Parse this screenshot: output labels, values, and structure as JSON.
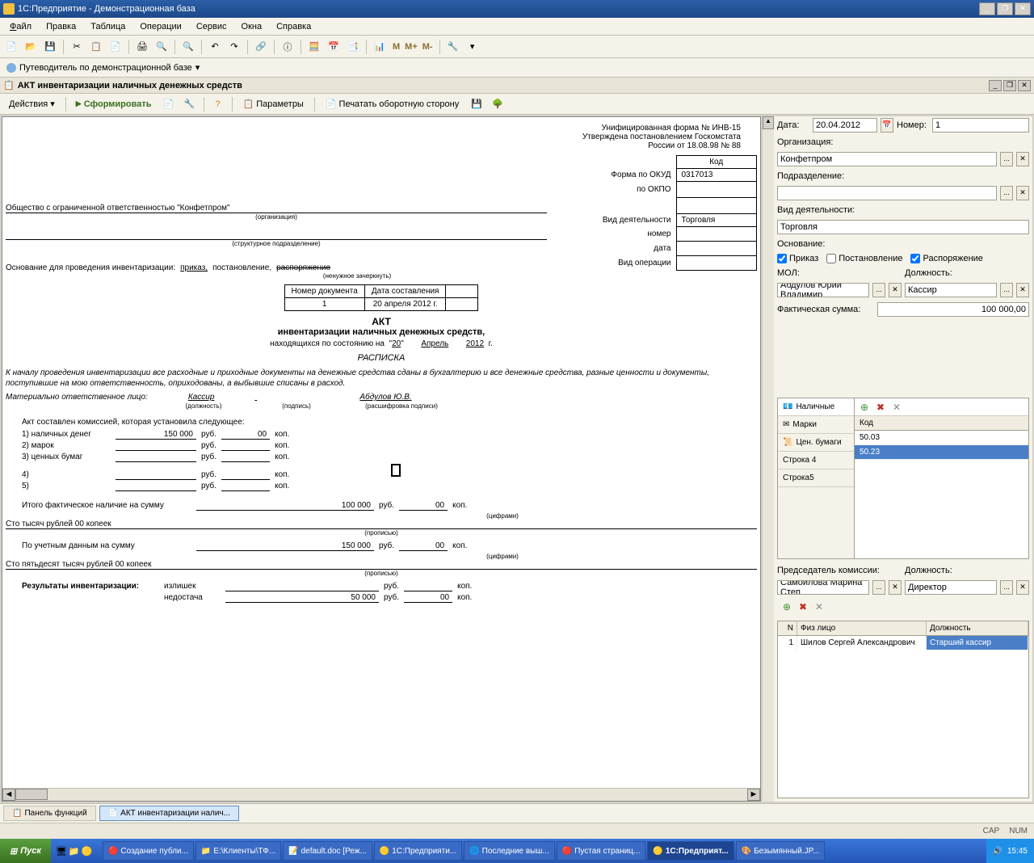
{
  "window": {
    "title": "1С:Предприятие - Демонстрационная база"
  },
  "menu": {
    "file": "Файл",
    "edit": "Правка",
    "table": "Таблица",
    "ops": "Операции",
    "service": "Сервис",
    "windows": "Окна",
    "help": "Справка"
  },
  "subtoolbar": {
    "guide": "Путеводитель по демонстрационной базе"
  },
  "m_buttons": {
    "m": "M",
    "mp": "M+",
    "mm": "M-"
  },
  "doc": {
    "title": "АКТ инвентаризации наличных денежных средств"
  },
  "actions": {
    "dd": "Действия",
    "form": "Сформировать",
    "params": "Параметры",
    "printback": "Печатать оборотную сторону"
  },
  "form_header": {
    "l1": "Унифицированная форма № ИНВ-15",
    "l2": "Утверждена постановлением Госкомстата",
    "l3": "России от 18.08.98 № 88"
  },
  "code_block": {
    "code": "Код",
    "okud_lbl": "Форма по ОКУД",
    "okud": "0317013",
    "okpo_lbl": "по ОКПО",
    "vid_lbl": "Вид деятельности",
    "vid": "Торговля",
    "nomer": "номер",
    "data": "дата",
    "vidop": "Вид операции"
  },
  "org": {
    "name": "Общество с ограниченной ответственностью \"Конфетпром\"",
    "hint1": "(организация)",
    "hint2": "(структурное подразделение)"
  },
  "osn": {
    "lbl": "Основание для проведения инвентаризации:",
    "prikaz": "приказ,",
    "post": "постановление,",
    "rasp": "распоряжение",
    "hint": "(ненужное зачеркнуть)"
  },
  "doc_table": {
    "h1": "Номер документа",
    "h2": "Дата составления",
    "v1": "1",
    "v2": "20 апреля 2012 г."
  },
  "akt": {
    "title": "АКТ",
    "subtitle": "инвентаризации наличных денежных средств,",
    "line": "находящихся по состоянию на",
    "day": "20",
    "month": "Апрель",
    "year": "2012",
    "g": "г."
  },
  "raspiska": "РАСПИСКА",
  "raspiska_text": "К началу проведения инвентаризации все расходные и приходные документы на денежные средства сданы в бухгалтерию и все денежные средства, разные ценности и документы, поступившие на мою ответственность, оприходованы, а выбывшие списаны в расход.",
  "mol": {
    "lbl": "Материально ответственное лицо:",
    "pos": "Кассир",
    "name": "Абдулов Ю.В.",
    "h1": "(должность)",
    "h2": "(подпись)",
    "h3": "(расшифровка подписи)"
  },
  "akt_lines": {
    "intro": "Акт составлен комиссией, которая установила следующее:",
    "l1": "1) наличных денег",
    "v1r": "150 000",
    "v1k": "00",
    "l2": "2) марок",
    "l3": "3) ценных бумаг",
    "l4": "4)",
    "l5": "5)",
    "rub": "руб.",
    "kop": "коп.",
    "total": "Итого фактическое наличие на сумму",
    "tv_r": "100 000",
    "tv_k": "00",
    "hint_cif": "(цифрами)",
    "words1": "Сто тысяч рублей 00 копеек",
    "hint_prop": "(прописью)",
    "acct": "По учетным данным на сумму",
    "acct_r": "150 000",
    "acct_k": "00",
    "words2": "Сто пятьдесят тысяч рублей 00 копеек",
    "res": "Результаты инвентаризации:",
    "izl": "излишек",
    "ned": "недостача",
    "ned_r": "50 000",
    "ned_k": "00"
  },
  "right": {
    "date_lbl": "Дата:",
    "date": "20.04.2012",
    "num_lbl": "Номер:",
    "num": "1",
    "org_lbl": "Организация:",
    "org": "Конфетпром",
    "podr_lbl": "Подразделение:",
    "vid_lbl": "Вид деятельности:",
    "vid": "Торговля",
    "osn_lbl": "Основание:",
    "chk1": "Приказ",
    "chk2": "Постановление",
    "chk3": "Распоряжение",
    "mol_lbl": "МОЛ:",
    "mol": "Абдулов Юрий Владимир",
    "pos_lbl": "Должность:",
    "pos": "Кассир",
    "fact_lbl": "Фактическая сумма:",
    "fact": "100 000,00",
    "tabs": {
      "t1": "Наличные",
      "t2": "Марки",
      "t3": "Цен. бумаги",
      "t4": "Строка 4",
      "t5": "Строка5"
    },
    "grid_h": "Код",
    "gr1": "50.03",
    "gr2": "50.23",
    "pred_lbl": "Председатель комиссии:",
    "pred_pos_lbl": "Должность:",
    "pred": "Самойлова Марина Степ",
    "pred_pos": "Директор",
    "ct": {
      "h1": "N",
      "h2": "Физ лицо",
      "h3": "Должность",
      "r1_n": "1",
      "r1_name": "Шилов Сергей Александрович",
      "r1_pos": "Старший кассир"
    }
  },
  "bottom_tabs": {
    "t1": "Панель функций",
    "t2": "АКТ инвентаризации налич..."
  },
  "status": {
    "cap": "CAP",
    "num": "NUM"
  },
  "taskbar": {
    "start": "Пуск",
    "t1": "Создание публи...",
    "t2": "E:\\Клиенты\\ТФ...",
    "t3": "default.doc [Реж...",
    "t4": "1С:Предприяти...",
    "t5": "Последние выш...",
    "t6": "Пустая страниц...",
    "t7": "1С:Предприят...",
    "t8": "Безымянный.JP...",
    "time": "15:45"
  }
}
